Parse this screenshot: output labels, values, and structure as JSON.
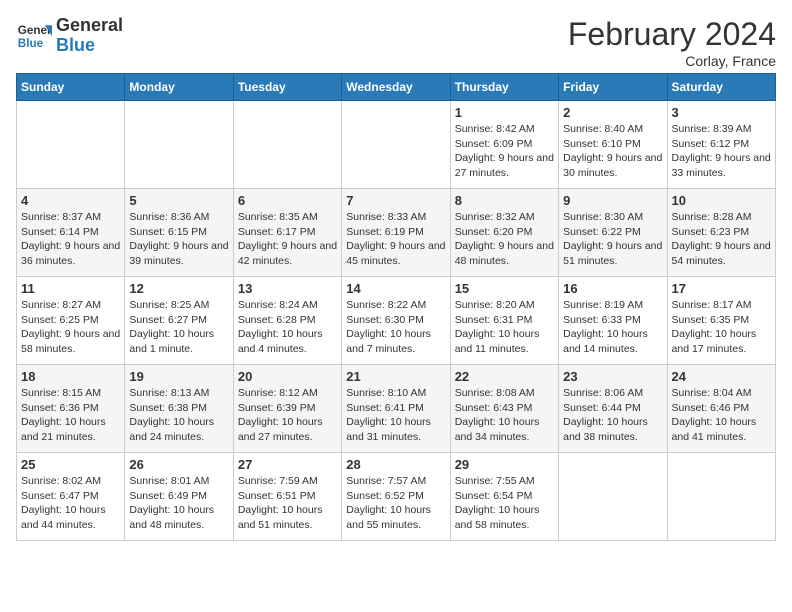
{
  "header": {
    "logo_text_general": "General",
    "logo_text_blue": "Blue",
    "month_title": "February 2024",
    "location": "Corlay, France"
  },
  "days_of_week": [
    "Sunday",
    "Monday",
    "Tuesday",
    "Wednesday",
    "Thursday",
    "Friday",
    "Saturday"
  ],
  "weeks": [
    [
      {
        "day": "",
        "info": ""
      },
      {
        "day": "",
        "info": ""
      },
      {
        "day": "",
        "info": ""
      },
      {
        "day": "",
        "info": ""
      },
      {
        "day": "1",
        "info": "Sunrise: 8:42 AM\nSunset: 6:09 PM\nDaylight: 9 hours and 27 minutes."
      },
      {
        "day": "2",
        "info": "Sunrise: 8:40 AM\nSunset: 6:10 PM\nDaylight: 9 hours and 30 minutes."
      },
      {
        "day": "3",
        "info": "Sunrise: 8:39 AM\nSunset: 6:12 PM\nDaylight: 9 hours and 33 minutes."
      }
    ],
    [
      {
        "day": "4",
        "info": "Sunrise: 8:37 AM\nSunset: 6:14 PM\nDaylight: 9 hours and 36 minutes."
      },
      {
        "day": "5",
        "info": "Sunrise: 8:36 AM\nSunset: 6:15 PM\nDaylight: 9 hours and 39 minutes."
      },
      {
        "day": "6",
        "info": "Sunrise: 8:35 AM\nSunset: 6:17 PM\nDaylight: 9 hours and 42 minutes."
      },
      {
        "day": "7",
        "info": "Sunrise: 8:33 AM\nSunset: 6:19 PM\nDaylight: 9 hours and 45 minutes."
      },
      {
        "day": "8",
        "info": "Sunrise: 8:32 AM\nSunset: 6:20 PM\nDaylight: 9 hours and 48 minutes."
      },
      {
        "day": "9",
        "info": "Sunrise: 8:30 AM\nSunset: 6:22 PM\nDaylight: 9 hours and 51 minutes."
      },
      {
        "day": "10",
        "info": "Sunrise: 8:28 AM\nSunset: 6:23 PM\nDaylight: 9 hours and 54 minutes."
      }
    ],
    [
      {
        "day": "11",
        "info": "Sunrise: 8:27 AM\nSunset: 6:25 PM\nDaylight: 9 hours and 58 minutes."
      },
      {
        "day": "12",
        "info": "Sunrise: 8:25 AM\nSunset: 6:27 PM\nDaylight: 10 hours and 1 minute."
      },
      {
        "day": "13",
        "info": "Sunrise: 8:24 AM\nSunset: 6:28 PM\nDaylight: 10 hours and 4 minutes."
      },
      {
        "day": "14",
        "info": "Sunrise: 8:22 AM\nSunset: 6:30 PM\nDaylight: 10 hours and 7 minutes."
      },
      {
        "day": "15",
        "info": "Sunrise: 8:20 AM\nSunset: 6:31 PM\nDaylight: 10 hours and 11 minutes."
      },
      {
        "day": "16",
        "info": "Sunrise: 8:19 AM\nSunset: 6:33 PM\nDaylight: 10 hours and 14 minutes."
      },
      {
        "day": "17",
        "info": "Sunrise: 8:17 AM\nSunset: 6:35 PM\nDaylight: 10 hours and 17 minutes."
      }
    ],
    [
      {
        "day": "18",
        "info": "Sunrise: 8:15 AM\nSunset: 6:36 PM\nDaylight: 10 hours and 21 minutes."
      },
      {
        "day": "19",
        "info": "Sunrise: 8:13 AM\nSunset: 6:38 PM\nDaylight: 10 hours and 24 minutes."
      },
      {
        "day": "20",
        "info": "Sunrise: 8:12 AM\nSunset: 6:39 PM\nDaylight: 10 hours and 27 minutes."
      },
      {
        "day": "21",
        "info": "Sunrise: 8:10 AM\nSunset: 6:41 PM\nDaylight: 10 hours and 31 minutes."
      },
      {
        "day": "22",
        "info": "Sunrise: 8:08 AM\nSunset: 6:43 PM\nDaylight: 10 hours and 34 minutes."
      },
      {
        "day": "23",
        "info": "Sunrise: 8:06 AM\nSunset: 6:44 PM\nDaylight: 10 hours and 38 minutes."
      },
      {
        "day": "24",
        "info": "Sunrise: 8:04 AM\nSunset: 6:46 PM\nDaylight: 10 hours and 41 minutes."
      }
    ],
    [
      {
        "day": "25",
        "info": "Sunrise: 8:02 AM\nSunset: 6:47 PM\nDaylight: 10 hours and 44 minutes."
      },
      {
        "day": "26",
        "info": "Sunrise: 8:01 AM\nSunset: 6:49 PM\nDaylight: 10 hours and 48 minutes."
      },
      {
        "day": "27",
        "info": "Sunrise: 7:59 AM\nSunset: 6:51 PM\nDaylight: 10 hours and 51 minutes."
      },
      {
        "day": "28",
        "info": "Sunrise: 7:57 AM\nSunset: 6:52 PM\nDaylight: 10 hours and 55 minutes."
      },
      {
        "day": "29",
        "info": "Sunrise: 7:55 AM\nSunset: 6:54 PM\nDaylight: 10 hours and 58 minutes."
      },
      {
        "day": "",
        "info": ""
      },
      {
        "day": "",
        "info": ""
      }
    ]
  ]
}
